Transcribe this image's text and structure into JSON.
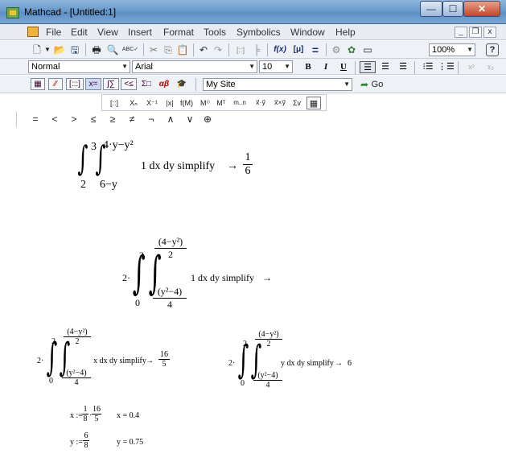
{
  "window": {
    "title": "Mathcad - [Untitled:1]",
    "controls": {
      "minimize": "—",
      "maximize": "☐",
      "close": "✕"
    }
  },
  "menu": {
    "items": [
      "File",
      "Edit",
      "View",
      "Insert",
      "Format",
      "Tools",
      "Symbolics",
      "Window",
      "Help"
    ],
    "mdi": {
      "minimize": "_",
      "restore": "❐",
      "close": "x"
    }
  },
  "toolbar1": {
    "zoom": "100%",
    "icons": [
      "new-icon",
      "open-icon",
      "save-icon",
      "print-icon",
      "print-preview-icon",
      "spell-check-icon",
      "cut-icon",
      "copy-icon",
      "paste-icon",
      "undo-icon",
      "redo-icon",
      "insert-matrix-icon",
      "insert-function-icon",
      "insert-unit-icon",
      "calculate-icon",
      "resource-icon",
      "component-icon",
      "help-icon"
    ],
    "glyphs": {
      "new": "🗋",
      "save": "🖫",
      "print": "🖶",
      "spell": "ABC✓",
      "cut": "✂",
      "copy": "⎘",
      "paste": "📋",
      "undo": "↶",
      "redo": "↷",
      "matrix": "[::]",
      "function": "f(x)",
      "unit": "[μ]",
      "equals": "=",
      "help": "?"
    }
  },
  "toolbar2": {
    "style": "Normal",
    "font": "Arial",
    "size": "10",
    "bold": "B",
    "italic": "I",
    "underline": "U",
    "superscript": "x²",
    "subscript": "x₂"
  },
  "toolbar3": {
    "site": "My Site",
    "go": "Go",
    "palette_labels": [
      "▦",
      "⁄⁄",
      "[:::]",
      "x=",
      "∫∑",
      "<≤",
      "Σ□",
      "αβ",
      "🎓"
    ]
  },
  "toolbar4": {
    "items": [
      "[::]",
      "Xₙ",
      "X⁻¹",
      "|x|",
      "f(M)",
      "M⁽⁾",
      "Mᵀ",
      "m..n",
      "x⃗·y⃗",
      "x⃗×y⃗",
      "Σv",
      "▦"
    ]
  },
  "toolbar5": {
    "items": [
      "=",
      "<",
      ">",
      "≤",
      "≥",
      "≠",
      "¬",
      "∧",
      "∨",
      "⊕"
    ]
  },
  "worksheet": {
    "expr1": {
      "outer_upper": "3",
      "outer_lower": "2",
      "inner_upper": "4·y−y²",
      "inner_lower": "6−y",
      "integrand": "1 dx dy simplify",
      "arrow": "→",
      "result_num": "1",
      "result_den": "6"
    },
    "expr2": {
      "coef": "2·",
      "outer_upper": "2",
      "outer_lower": "0",
      "upper_num": "(4−y²)",
      "upper_den": "2",
      "lower_num": "(y²−4)",
      "lower_den": "4",
      "integrand": "1 dx dy simplify",
      "arrow": "→"
    },
    "expr3": {
      "coef": "2·",
      "outer_upper": "2",
      "outer_lower": "0",
      "upper_num": "(4−y²)",
      "upper_den": "2",
      "lower_num": "(y²−4)",
      "lower_den": "4",
      "integrand": "x dx dy simplify",
      "arrow": "→",
      "result_num": "16",
      "result_den": "5"
    },
    "expr4": {
      "coef": "2·",
      "outer_upper": "2",
      "outer_lower": "0",
      "upper_num": "(4−y²)",
      "upper_den": "2",
      "lower_num": "(y²−4)",
      "lower_den": "4",
      "integrand": "y dx dy simplify",
      "arrow": "→",
      "result": "6"
    },
    "x_def": {
      "lhs": "x :=",
      "f1_num": "1",
      "f1_den": "8",
      "f2_num": "16",
      "f2_den": "5",
      "eval": "x = 0.4"
    },
    "y_def": {
      "lhs": "y :=",
      "num": "6",
      "den": "8",
      "eval": "y = 0.75"
    }
  }
}
